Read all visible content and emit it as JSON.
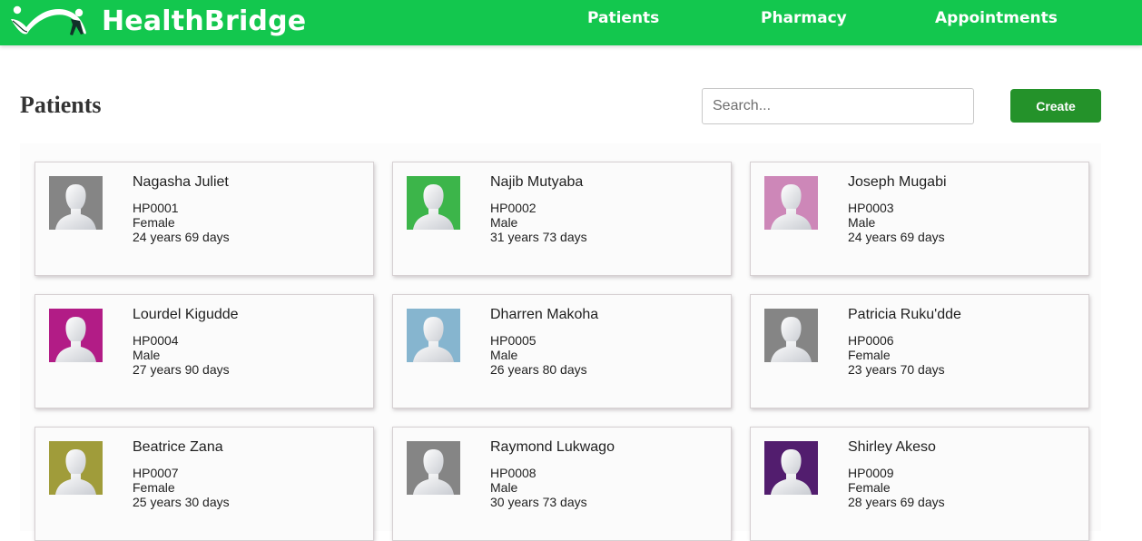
{
  "header": {
    "brand": "HealthBridge",
    "colors": {
      "bar": "#13c74e",
      "text": "#ffffff"
    },
    "nav": [
      {
        "label": "Patients"
      },
      {
        "label": "Pharmacy"
      },
      {
        "label": "Appointments"
      }
    ]
  },
  "main": {
    "title": "Patients",
    "search": {
      "placeholder": "Search...",
      "value": ""
    },
    "create_label": "Create",
    "create_color": "#24922a"
  },
  "patients": [
    {
      "name": "Nagasha Juliet",
      "id": "HP0001",
      "gender": "Female",
      "age": "24 years 69 days",
      "avatar_color": "#858585"
    },
    {
      "name": "Najib Mutyaba",
      "id": "HP0002",
      "gender": "Male",
      "age": "31 years 73 days",
      "avatar_color": "#3cb54a"
    },
    {
      "name": "Joseph Mugabi",
      "id": "HP0003",
      "gender": "Male",
      "age": "24 years 69 days",
      "avatar_color": "#cd87b8"
    },
    {
      "name": "Lourdel Kigudde",
      "id": "HP0004",
      "gender": "Male",
      "age": "27 years 90 days",
      "avatar_color": "#b21c86"
    },
    {
      "name": "Dharren Makoha",
      "id": "HP0005",
      "gender": "Male",
      "age": "26 years 80 days",
      "avatar_color": "#86b5cf"
    },
    {
      "name": "Patricia Ruku'dde",
      "id": "HP0006",
      "gender": "Female",
      "age": "23 years 70 days",
      "avatar_color": "#858585"
    },
    {
      "name": "Beatrice Zana",
      "id": "HP0007",
      "gender": "Female",
      "age": "25 years 30 days",
      "avatar_color": "#a09c3a"
    },
    {
      "name": "Raymond Lukwago",
      "id": "HP0008",
      "gender": "Male",
      "age": "30 years 73 days",
      "avatar_color": "#858585"
    },
    {
      "name": "Shirley Akeso",
      "id": "HP0009",
      "gender": "Female",
      "age": "28 years 69 days",
      "avatar_color": "#521d6e"
    }
  ]
}
